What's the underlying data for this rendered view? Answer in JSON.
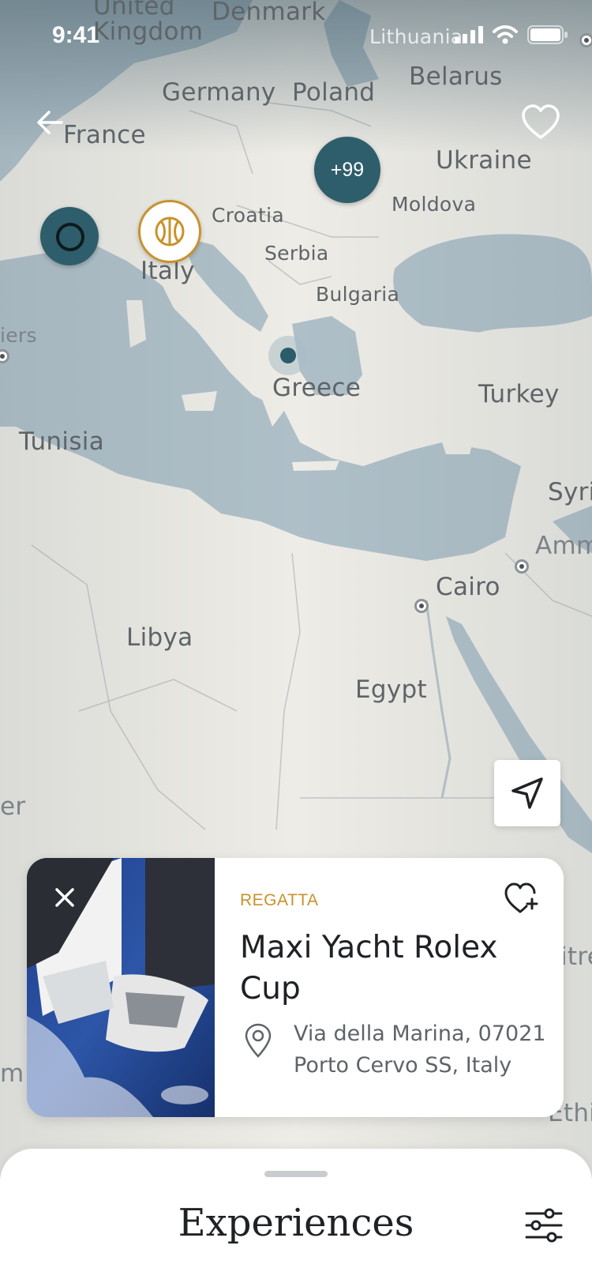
{
  "status_bar": {
    "time": "9:41"
  },
  "map": {
    "labels": {
      "united_kingdom": "United\nKingdom",
      "denmark": "Denmark",
      "lithuania": "Lithuania",
      "belarus": "Belarus",
      "germany": "Germany",
      "poland": "Poland",
      "france": "France",
      "ukraine": "Ukraine",
      "moldova": "Moldova",
      "croatia": "Croatia",
      "italy": "Italy",
      "serbia": "Serbia",
      "bulgaria": "Bulgaria",
      "algiers": "iers",
      "greece": "Greece",
      "turkey": "Turkey",
      "tunisia": "Tunisia",
      "syria": "Syri",
      "amman": "Amm",
      "cairo": "Cairo",
      "libya": "Libya",
      "egypt": "Egypt",
      "edge_left_1": "er",
      "edge_left_2": "m",
      "edge_right_1": "itre",
      "edge_right_2": "Ethi"
    },
    "cluster_count": "+99",
    "colors": {
      "sea": "#aebfc8",
      "land": "#eeece6",
      "marker": "#2e5e6b",
      "accent": "#c9922c"
    }
  },
  "card": {
    "category": "REGATTA",
    "title": "Maxi Yacht Rolex Cup",
    "address_line1": "Via della Marina, 07021",
    "address_line2": "Porto Cervo SS, Italy"
  },
  "sheet": {
    "title": "Experiences"
  },
  "icons": {
    "back": "arrow-left-icon",
    "favorite": "heart-icon",
    "card_favorite": "heart-plus-icon",
    "close": "close-icon",
    "location_pin": "location-pin-icon",
    "navigate": "navigation-arrow-icon",
    "filter": "sliders-icon",
    "basketball": "basketball-icon"
  }
}
